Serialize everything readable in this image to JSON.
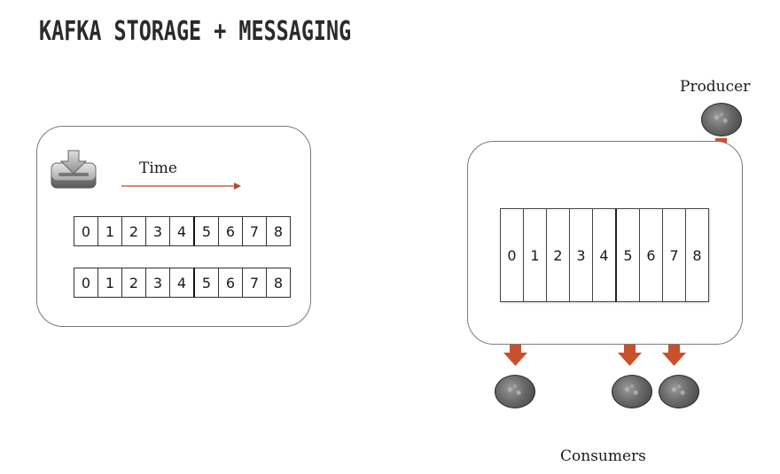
{
  "title": "KAFKA STORAGE + MESSAGING",
  "storage": {
    "time_label": "Time",
    "rows": [
      [
        "0",
        "1",
        "2",
        "3",
        "4",
        "5",
        "6",
        "7",
        "8"
      ],
      [
        "0",
        "1",
        "2",
        "3",
        "4",
        "5",
        "6",
        "7",
        "8"
      ]
    ]
  },
  "messaging": {
    "producer_label": "Producer",
    "consumers_label": "Consumers",
    "partition": [
      "0",
      "1",
      "2",
      "3",
      "4",
      "5",
      "6",
      "7",
      "8"
    ]
  },
  "colors": {
    "arrow": "#c8502c",
    "time_arrow": "#b5472a",
    "border": "#7a7a7a"
  },
  "icons": [
    "download-disk-icon",
    "envelope-icon"
  ]
}
